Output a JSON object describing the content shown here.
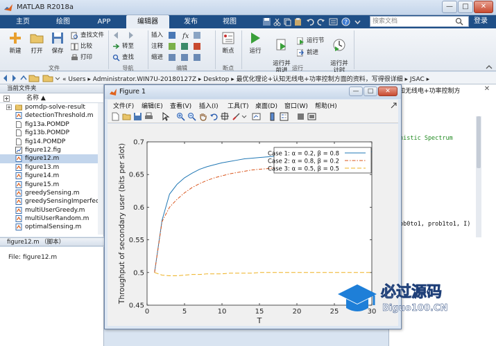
{
  "app": {
    "title": "MATLAB R2018a",
    "window_buttons": {
      "minimize": "—",
      "maximize": "□",
      "close": "✕"
    }
  },
  "tabs": [
    {
      "label": "主页",
      "active": false
    },
    {
      "label": "绘图",
      "active": false
    },
    {
      "label": "APP",
      "active": false
    },
    {
      "label": "编辑器",
      "active": true
    },
    {
      "label": "发布",
      "active": false
    },
    {
      "label": "视图",
      "active": false
    }
  ],
  "search": {
    "placeholder": "搜索文档"
  },
  "login_label": "登录",
  "ribbon": {
    "groups": [
      {
        "label": "文件"
      },
      {
        "label": "导航"
      },
      {
        "label": "编辑"
      },
      {
        "label": "断点"
      },
      {
        "label": "运行"
      }
    ],
    "file": {
      "new": "新建",
      "open": "打开",
      "save": "保存",
      "find_files": "查找文件",
      "compare": "比较",
      "print": "打印"
    },
    "nav": {
      "goto": "转至",
      "find": "查找"
    },
    "edit": {
      "insert": "插入",
      "comment": "注释",
      "indent": "缩进"
    },
    "breakpoints": {
      "label": "断点"
    },
    "run": {
      "run": "运行",
      "run_advance": "运行并\n前进",
      "run_section": "运行节",
      "advance": "前进",
      "run_time": "运行并\n计时"
    }
  },
  "address": {
    "path": "«  Users  ▸  Administrator.WIN7U-20180127Z  ▸  Desktop  ▸  最优化理论+认知无线电+功率控制方面的资料，写得很详细  ▸  JSAC  ▸"
  },
  "folder_panel": {
    "title": "当前文件夹",
    "column": "名称 ▲",
    "items": [
      {
        "name": "pomdp-solve-result",
        "type": "folder",
        "selected": false
      },
      {
        "name": "detectionThreshold.m",
        "type": "m",
        "selected": false
      },
      {
        "name": "fig13a.POMDP",
        "type": "file",
        "selected": false
      },
      {
        "name": "fig13b.POMDP",
        "type": "file",
        "selected": false
      },
      {
        "name": "fig14.POMDP",
        "type": "file",
        "selected": false
      },
      {
        "name": "figure12.fig",
        "type": "fig",
        "selected": false
      },
      {
        "name": "figure12.m",
        "type": "m",
        "selected": true
      },
      {
        "name": "figure13.m",
        "type": "m",
        "selected": false
      },
      {
        "name": "figure14.m",
        "type": "m",
        "selected": false
      },
      {
        "name": "figure15.m",
        "type": "m",
        "selected": false
      },
      {
        "name": "greedySensing.m",
        "type": "m",
        "selected": false
      },
      {
        "name": "greedySensingImperfect...",
        "type": "m",
        "selected": false
      },
      {
        "name": "multiUserGreedy.m",
        "type": "m",
        "selected": false
      },
      {
        "name": "multiUserRandom.m",
        "type": "m",
        "selected": false
      },
      {
        "name": "optimalSensing.m",
        "type": "m",
        "selected": false
      }
    ]
  },
  "details": {
    "header": "figure12.m （脚本）",
    "content": "File: figure12.m"
  },
  "editor": {
    "tab_text": "知无线电+功率控制方",
    "code_comment": "nistic Spectrum",
    "code_line": "ob0to1, prob1to1, I)"
  },
  "figure": {
    "title": "Figure 1",
    "menus": [
      "文件(F)",
      "编辑(E)",
      "查看(V)",
      "插入(I)",
      "工具(T)",
      "桌面(D)",
      "窗口(W)",
      "帮助(H)"
    ]
  },
  "chart_data": {
    "type": "line",
    "title": "",
    "xlabel": "T",
    "ylabel": "Throughput of secondary user (bits per slot)",
    "xlim": [
      0,
      30
    ],
    "ylim": [
      0.45,
      0.7
    ],
    "xticks": [
      0,
      5,
      10,
      15,
      20,
      25,
      30
    ],
    "yticks": [
      0.45,
      0.5,
      0.55,
      0.6,
      0.65,
      0.7
    ],
    "grid": false,
    "legend_position": "top-right",
    "series": [
      {
        "name": "Case 1: α = 0.2, β = 0.8",
        "color": "#1f77b4",
        "dash": "solid",
        "x": [
          1,
          2,
          3,
          4,
          5,
          6,
          7,
          8,
          9,
          10,
          11,
          12,
          13,
          14,
          15,
          16,
          17,
          18,
          19,
          20,
          21,
          22,
          23,
          24,
          25,
          26,
          27,
          28,
          29,
          30
        ],
        "y": [
          0.5,
          0.58,
          0.62,
          0.635,
          0.645,
          0.652,
          0.658,
          0.662,
          0.665,
          0.668,
          0.67,
          0.672,
          0.674,
          0.675,
          0.676,
          0.677,
          0.678,
          0.679,
          0.68,
          0.681,
          0.681,
          0.682,
          0.682,
          0.683,
          0.683,
          0.684,
          0.684,
          0.684,
          0.685,
          0.685
        ]
      },
      {
        "name": "Case 2: α = 0.8, β = 0.2",
        "color": "#d95319",
        "dash": "dashdot",
        "x": [
          1,
          2,
          3,
          4,
          5,
          6,
          7,
          8,
          9,
          10,
          11,
          12,
          13,
          14,
          15,
          16,
          17,
          18,
          19,
          20,
          21,
          22,
          23,
          24,
          25,
          26,
          27,
          28,
          29,
          30
        ],
        "y": [
          0.5,
          0.578,
          0.6,
          0.612,
          0.622,
          0.63,
          0.636,
          0.641,
          0.645,
          0.648,
          0.651,
          0.653,
          0.655,
          0.657,
          0.658,
          0.659,
          0.66,
          0.661,
          0.662,
          0.663,
          0.663,
          0.664,
          0.664,
          0.665,
          0.665,
          0.666,
          0.666,
          0.666,
          0.667,
          0.667
        ]
      },
      {
        "name": "Case 3: α = 0.5, β = 0.5",
        "color": "#edb120",
        "dash": "dashed",
        "x": [
          1,
          2,
          3,
          4,
          5,
          6,
          7,
          8,
          9,
          10,
          11,
          12,
          13,
          14,
          15,
          16,
          17,
          18,
          19,
          20,
          21,
          22,
          23,
          24,
          25,
          26,
          27,
          28,
          29,
          30
        ],
        "y": [
          0.5,
          0.496,
          0.495,
          0.495,
          0.496,
          0.497,
          0.497,
          0.498,
          0.498,
          0.498,
          0.499,
          0.499,
          0.499,
          0.499,
          0.5,
          0.5,
          0.5,
          0.5,
          0.5,
          0.5,
          0.5,
          0.5,
          0.5,
          0.5,
          0.5,
          0.5,
          0.5,
          0.5,
          0.5,
          0.5
        ]
      }
    ]
  },
  "watermark": {
    "title": "必过源码",
    "url": "Biguo100.CN"
  }
}
